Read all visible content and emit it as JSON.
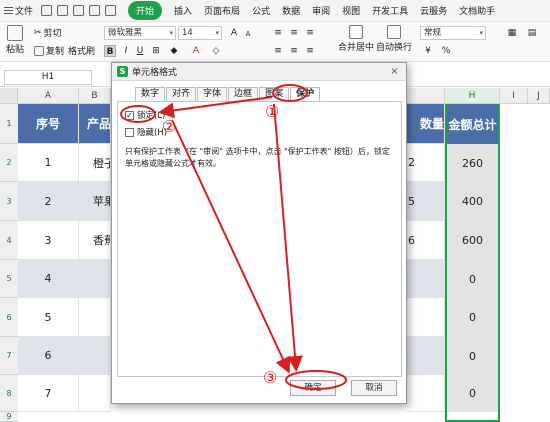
{
  "menubar": {
    "file": "文件",
    "tabs": [
      "开始",
      "插入",
      "页面布局",
      "公式",
      "数据",
      "审阅",
      "视图",
      "开发工具",
      "云服务",
      "文档助手"
    ],
    "active_tab": "开始"
  },
  "ribbon": {
    "paste": "粘贴",
    "cut": "剪切",
    "copy": "复制",
    "format_painter": "格式刷",
    "font_name": "微软雅黑",
    "font_size": "14",
    "merge_center": "合并居中",
    "wrap_text": "自动换行",
    "number_format": "常规",
    "bold": "B",
    "italic": "I",
    "underline": "U",
    "currency": "¥",
    "percent": "%"
  },
  "formula_bar": {
    "name_box": "H1"
  },
  "grid": {
    "columns": [
      "A",
      "B",
      "H",
      "I",
      "J"
    ],
    "rows": [
      "1",
      "2",
      "3",
      "4",
      "5",
      "6",
      "7",
      "8",
      "9"
    ],
    "headers": {
      "seq": "序号",
      "product": "产品名",
      "qty": "数量",
      "total": "金额总计"
    },
    "data": [
      {
        "seq": "1",
        "product": "橙子",
        "qty": "2",
        "total": "260"
      },
      {
        "seq": "2",
        "product": "苹果",
        "qty": "5",
        "total": "400"
      },
      {
        "seq": "3",
        "product": "香蕉",
        "qty": "6",
        "total": "600"
      },
      {
        "seq": "4",
        "product": "",
        "qty": "",
        "total": "0"
      },
      {
        "seq": "5",
        "product": "",
        "qty": "",
        "total": "0"
      },
      {
        "seq": "6",
        "product": "",
        "qty": "",
        "total": "0"
      },
      {
        "seq": "7",
        "product": "",
        "qty": "",
        "total": "0"
      }
    ]
  },
  "dialog": {
    "title": "单元格格式",
    "tabs": [
      "数字",
      "对齐",
      "字体",
      "边框",
      "图案",
      "保护"
    ],
    "active_tab": "保护",
    "locked_label": "锁定(L)",
    "locked_checked": true,
    "hidden_label": "隐藏(H)",
    "hidden_checked": false,
    "note": "只有保护工作表（在 \"审阅\" 选项卡中，点击 \"保护工作表\" 按钮）后，锁定单元格或隐藏公式才有效。",
    "ok": "确定",
    "cancel": "取消",
    "checkmark": "✓",
    "close": "×"
  },
  "annotations": {
    "step1": "①",
    "step2": "②",
    "step3": "③"
  },
  "colors": {
    "accent_green": "#1fa14a",
    "header_blue": "#4b6ea8",
    "annotation_red": "#d62020"
  }
}
